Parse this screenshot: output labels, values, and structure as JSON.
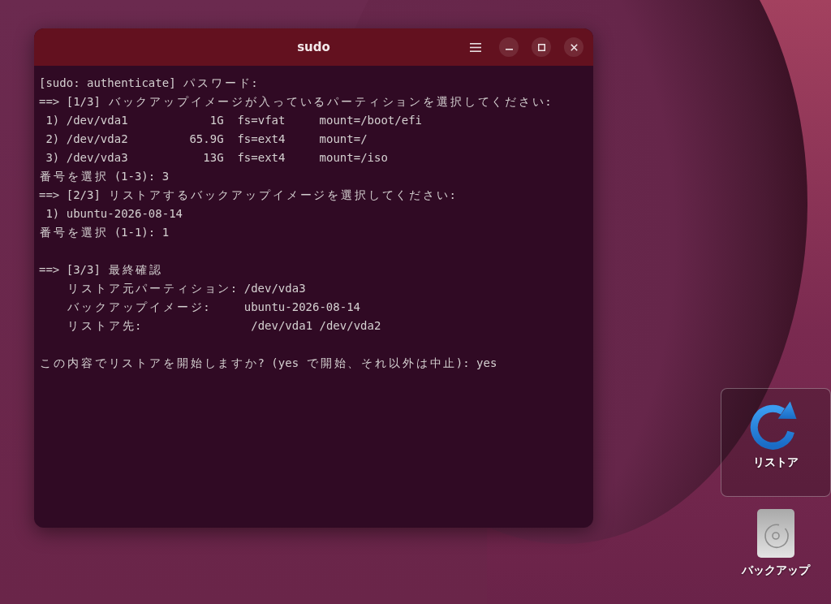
{
  "window": {
    "title": "sudo"
  },
  "terminal": {
    "blocks": [
      [
        "[sudo: authenticate] パスワード:",
        "==> [1/3] バックアップイメージが入っているパーティションを選択してください:",
        " 1) /dev/vda1            1G  fs=vfat     mount=/boot/efi",
        " 2) /dev/vda2         65.9G  fs=ext4     mount=/",
        " 3) /dev/vda3           13G  fs=ext4     mount=/iso",
        "番号を選択 (1-3): 3",
        "==> [2/3] リストアするバックアップイメージを選択してください:",
        " 1) ubuntu-2026-08-14",
        "番号を選択 (1-1): 1"
      ],
      [
        "==> [3/3] 最終確認",
        "    リストア元パーティション: /dev/vda3",
        "    バックアップイメージ:     ubuntu-2026-08-14",
        "    リストア先:                /dev/vda1 /dev/vda2"
      ],
      [
        "この内容でリストアを開始しますか? (yes で開始、それ以外は中止): yes"
      ]
    ]
  },
  "desktop_icons": [
    {
      "label": "リストア",
      "kind": "restore",
      "selected": true
    },
    {
      "label": "バックアップ",
      "kind": "backup",
      "selected": false
    }
  ]
}
